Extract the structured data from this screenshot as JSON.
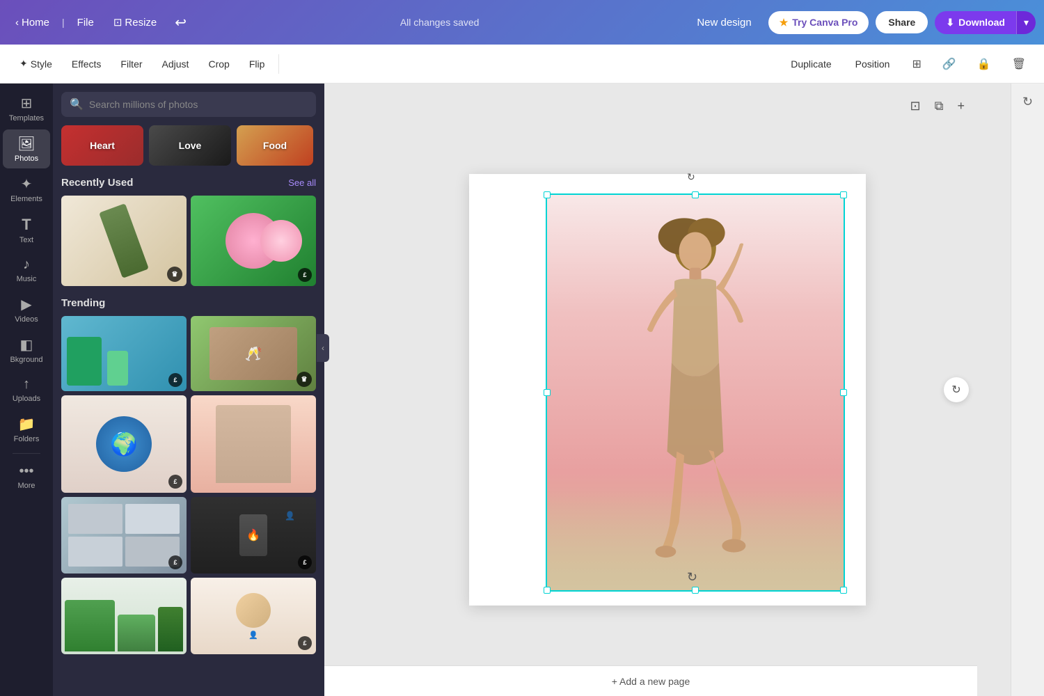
{
  "navbar": {
    "home_label": "Home",
    "file_label": "File",
    "resize_label": "Resize",
    "saved_label": "All changes saved",
    "new_design_label": "New design",
    "try_pro_label": "Try Canva Pro",
    "share_label": "Share",
    "download_label": "Download"
  },
  "toolbar2": {
    "style_label": "Style",
    "effects_label": "Effects",
    "filter_label": "Filter",
    "adjust_label": "Adjust",
    "crop_label": "Crop",
    "flip_label": "Flip",
    "duplicate_label": "Duplicate",
    "position_label": "Position"
  },
  "sidebar": {
    "items": [
      {
        "id": "templates",
        "label": "Templates",
        "icon": "⊞"
      },
      {
        "id": "photos",
        "label": "Photos",
        "icon": "🖼"
      },
      {
        "id": "elements",
        "label": "Elements",
        "icon": "✦"
      },
      {
        "id": "text",
        "label": "Text",
        "icon": "T"
      },
      {
        "id": "music",
        "label": "Music",
        "icon": "♪"
      },
      {
        "id": "videos",
        "label": "Videos",
        "icon": "▶"
      },
      {
        "id": "background",
        "label": "Bkground",
        "icon": "◧"
      },
      {
        "id": "uploads",
        "label": "Uploads",
        "icon": "↑"
      },
      {
        "id": "folders",
        "label": "Folders",
        "icon": "📁"
      },
      {
        "id": "more",
        "label": "More",
        "icon": "•••"
      }
    ]
  },
  "photos_panel": {
    "search_placeholder": "Search millions of photos",
    "categories": [
      {
        "label": "Heart",
        "color1": "#e53e3e",
        "color2": "#c53030"
      },
      {
        "label": "Love",
        "color1": "#444444",
        "color2": "#222222"
      },
      {
        "label": "Food",
        "color1": "#f6ad55",
        "color2": "#e53e3e"
      }
    ],
    "recently_used_label": "Recently Used",
    "see_all_label": "See all",
    "trending_label": "Trending"
  },
  "canvas": {
    "add_page_label": "+ Add a new page"
  }
}
